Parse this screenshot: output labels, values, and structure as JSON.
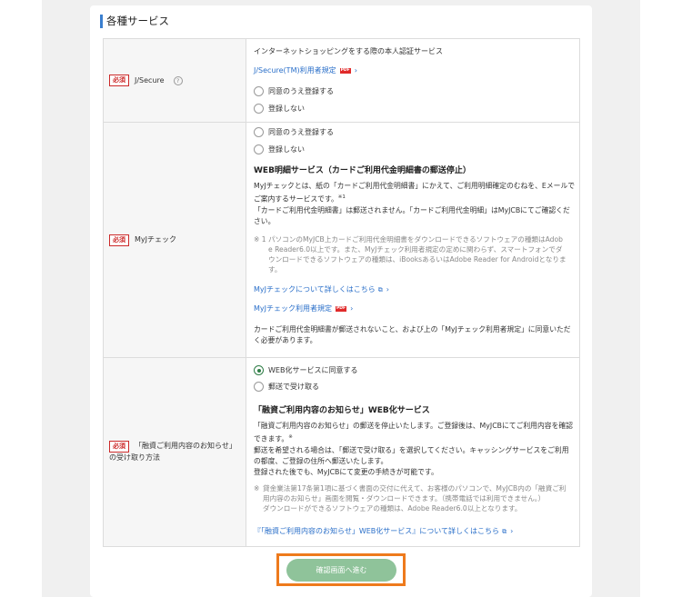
{
  "section_title": "各種サービス",
  "required_label": "必須",
  "jsecure": {
    "label": "J/Secure",
    "help": "?",
    "description": "インターネットショッピングをする際の本人認証サービス",
    "terms_link": "J/Secure(TM)利用者規定",
    "pdf": "PDF",
    "options": [
      "同意のうえ登録する",
      "登録しない"
    ]
  },
  "myj": {
    "label": "MyJチェック",
    "options": [
      "同意のうえ登録する",
      "登録しない"
    ],
    "heading": "WEB明細サービス（カードご利用代金明細書の郵送停止）",
    "para1_line1": "MyJチェックとは、紙の「カードご利用代金明細書」にかえて、ご利用明細確定のむねを、Eメールで",
    "para1_line2": "ご案内するサービスです。",
    "para1_sup": "※1",
    "para1_line3": "「カードご利用代金明細書」は郵送されません。「カードご利用代金明細」はMyJCBにてご確認くだ",
    "para1_line4": "さい。",
    "note_mark": "※ 1",
    "note_line1": "パソコンのMyJCB上カードご利用代金明細書をダウンロードできるソフトウェアの種類はAdob",
    "note_line2": "e Reader6.0以上です。また、MyJチェック利用者規定の定めに関わらず、スマートフォンでダ",
    "note_line3": "ウンロードできるソフトウェアの種類は、iBooksあるいはAdobe Reader for Androidとなりま",
    "note_line4": "す。",
    "details_link": "MyJチェックについて詳しくはこちら",
    "terms_link": "MyJチェック利用者規定",
    "pdf": "PDF",
    "footer_line1": "カードご利用代金明細書が郵送されないこと、および上の「MyJチェック利用者規定」に同意いただ",
    "footer_line2": "く必要があります。"
  },
  "loan": {
    "label_line1": "「融資ご利用内容のお知らせ」",
    "label_line2": "の受け取り方法",
    "options": [
      "WEB化サービスに同意する",
      "郵送で受け取る"
    ],
    "selected_index": 0,
    "heading": "「融資ご利用内容のお知らせ」WEB化サービス",
    "para_line1": "「融資ご利用内容のお知らせ」の郵送を停止いたします。ご登録後は、MyJCBにてご利用内容を確認",
    "para_line2": "できます。",
    "para_sup": "※",
    "para_line3": "郵送を希望される場合は、「郵送で受け取る」を選択してください。キャッシングサービスをご利用",
    "para_line4": "の都度、ご登録の住所へ郵送いたします。",
    "para_line5": "登録された後でも、MyJCBにて変更の手続きが可能です。",
    "note_mark": "※",
    "note_line1": "貸金業法第17条第1項に基づく書面の交付に代えて、お客様のパソコンで、MyJCB内の「融資ご利",
    "note_line2": "用内容のお知らせ」画面を閲覧・ダウンロードできます。（携帯電話では利用できません。）",
    "note_line3": "ダウンロードができるソフトウェアの種類は、Adobe Reader6.0以上となります。",
    "details_link": "『「融資ご利用内容のお知らせ」WEB化サービス』について詳しくはこちら"
  },
  "confirm_button": "確認画面へ進む"
}
